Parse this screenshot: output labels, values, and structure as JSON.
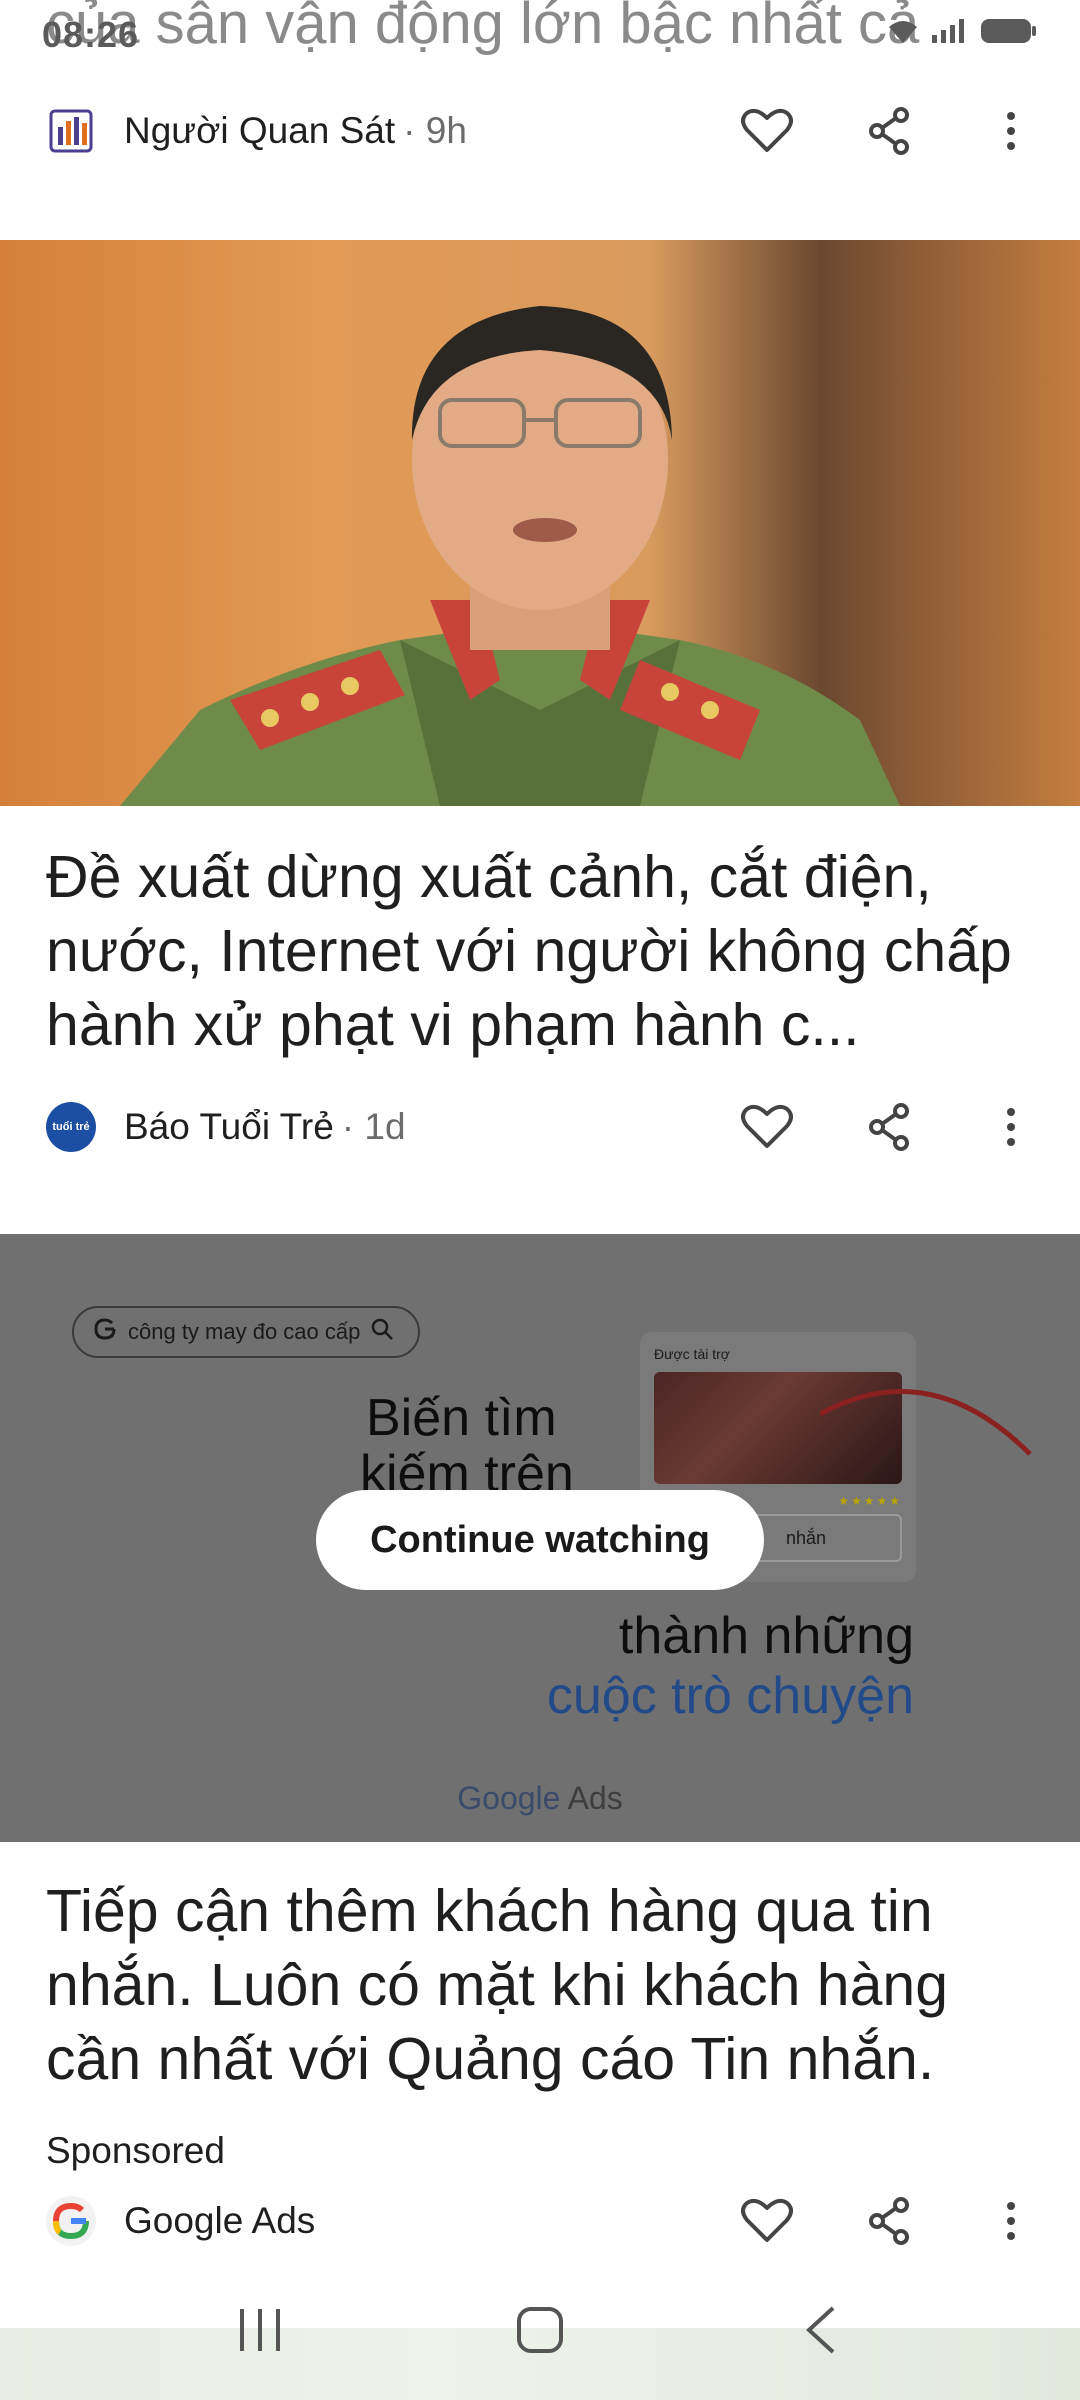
{
  "status_bar": {
    "time": "08:26"
  },
  "top_card": {
    "headline_fragment": "của sân vận động lớn bậc nhất cả",
    "source_name": "Người Quan Sát",
    "time_ago": "· 9h"
  },
  "article": {
    "headline": "Đề xuất dừng xuất cảnh, cắt điện, nước, Internet với người không chấp hành xử phạt vi phạm hành c...",
    "source_name": "Báo Tuổi Trẻ",
    "source_logo_text": "tuổi trẻ",
    "time_ago": "· 1d"
  },
  "ad": {
    "search_query": "công ty may đo cao cấp",
    "line_1": "Biến tìm",
    "line_2": "kiếm trên",
    "card_label": "Được tài trợ",
    "card_field": "nhắn",
    "continue_label": "Continue watching",
    "line_3": "thành những",
    "line_4": "cuộc trò chuyện",
    "brand_google": "Google",
    "brand_ads": " Ads",
    "headline": "Tiếp cận thêm khách hàng qua tin nhắn. Luôn có mặt khi khách hàng cần nhất với Quảng cáo Tin nhắn.",
    "sponsored_label": "Sponsored",
    "advertiser": "Google Ads"
  },
  "colors": {
    "accent_blue": "#234a88",
    "text_primary": "#1f1f1f",
    "text_secondary": "#6b6b6b",
    "ad_overlay": "#707070"
  }
}
